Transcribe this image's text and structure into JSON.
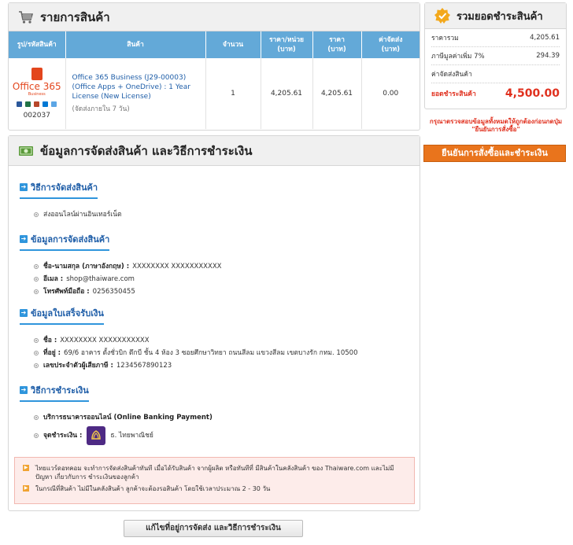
{
  "products": {
    "title": "รายการสินค้า",
    "columns": [
      "รูป/รหัสสินค้า",
      "สินค้า",
      "จำนวน",
      "ราคา/หน่วย\n(บาท)",
      "ราคา\n(บาท)",
      "ค่าจัดส่ง\n(บาท)"
    ],
    "item": {
      "logo_name": "Office 365",
      "logo_sub": "Business",
      "code": "002037",
      "name": "Office 365 Business (J29-00003) (Office Apps + OneDrive) : 1 Year License (New License)",
      "note": "(จัดส่งภายใน 7 วัน)",
      "qty": "1",
      "unit_price": "4,205.61",
      "price": "4,205.61",
      "shipping": "0.00"
    }
  },
  "shipping": {
    "title": "ข้อมูลการจัดส่งสินค้า และวิธีการชำระเงิน",
    "method": {
      "title": "วิธีการจัดส่งสินค้า",
      "value": "ส่งออนไลน์ผ่านอินเทอร์เน็ต"
    },
    "contact": {
      "title": "ข้อมูลการจัดส่งสินค้า",
      "name_label": "ชื่อ-นามสกุล (ภาษาอังกฤษ) :",
      "name_value": "XXXXXXXX XXXXXXXXXXX",
      "email_label": "อีเมล :",
      "email_value": "shop@thaiware.com",
      "phone_label": "โทรศัพท์มือถือ :",
      "phone_value": "0256350455"
    },
    "invoice": {
      "title": "ข้อมูลใบเสร็จรับเงิน",
      "name_label": "ชื่อ :",
      "name_value": "XXXXXXXX XXXXXXXXXXX",
      "address_label": "ที่อยู่ :",
      "address_value": "69/6 อาคาร ตั้งชั่วบิก ตึกบี ชั้น 4 ห้อง 3 ซอยศึกษาวิทยา ถนนสีลม แขวงสีลม เขตบางรัก กทม. 10500",
      "tax_label": "เลขประจำตัวผู้เสียภาษี :",
      "tax_value": "1234567890123"
    },
    "payment": {
      "title": "วิธีการชำระเงิน",
      "method": "บริการธนาคารออนไลน์ (Online Banking Payment)",
      "point_label": "จุดชำระเงิน :",
      "bank_name": "ธ. ไทยพาณิชย์"
    },
    "notes": [
      "ไทยแวร์ดอทคอม จะทำการจัดส่งสินค้าทันที เมื่อได้รับสินค้า จากผู้ผลิต หรือทันทีที่ มีสินค้าในคลังสินค้า ของ Thaiware.com และไม่มีปัญหา เกี่ยวกับการ ชำระเงินของลูกค้า",
      "ในกรณีที่สินค้า ไม่มีในคลังสินค้า ลูกค้าจะต้องรอสินค้า โดยใช้เวลาประมาณ 2 - 30 วัน"
    ],
    "edit_label": "แก้ไขที่อยู่การจัดส่ง และวิธีการชำระเงิน"
  },
  "summary": {
    "title": "รวมยอดชำระสินค้า",
    "rows": [
      {
        "label": "ราคารวม",
        "value": "4,205.61"
      },
      {
        "label": "ภาษีมูลค่าเพิ่ม 7%",
        "value": "294.39"
      },
      {
        "label": "ค่าจัดส่งสินค้า",
        "value": ""
      }
    ],
    "total_label": "ยอดชำระสินค้า",
    "total_value": "4,500.00",
    "warning": "กรุณาตรวจสอบข้อมูลทั้งหมดให้ถูกต้องก่อนกดปุ่ม \"ยืนยันการสั่งซื้อ\"",
    "confirm_label": "ยืนยันการสั่งซื้อและชำระเงิน"
  },
  "colors": {
    "header_blue": "#63a9d8",
    "link_blue": "#1f5ea8",
    "accent_orange": "#e9741c",
    "total_red": "#e0301e",
    "bank_purple": "#4e2a84"
  }
}
